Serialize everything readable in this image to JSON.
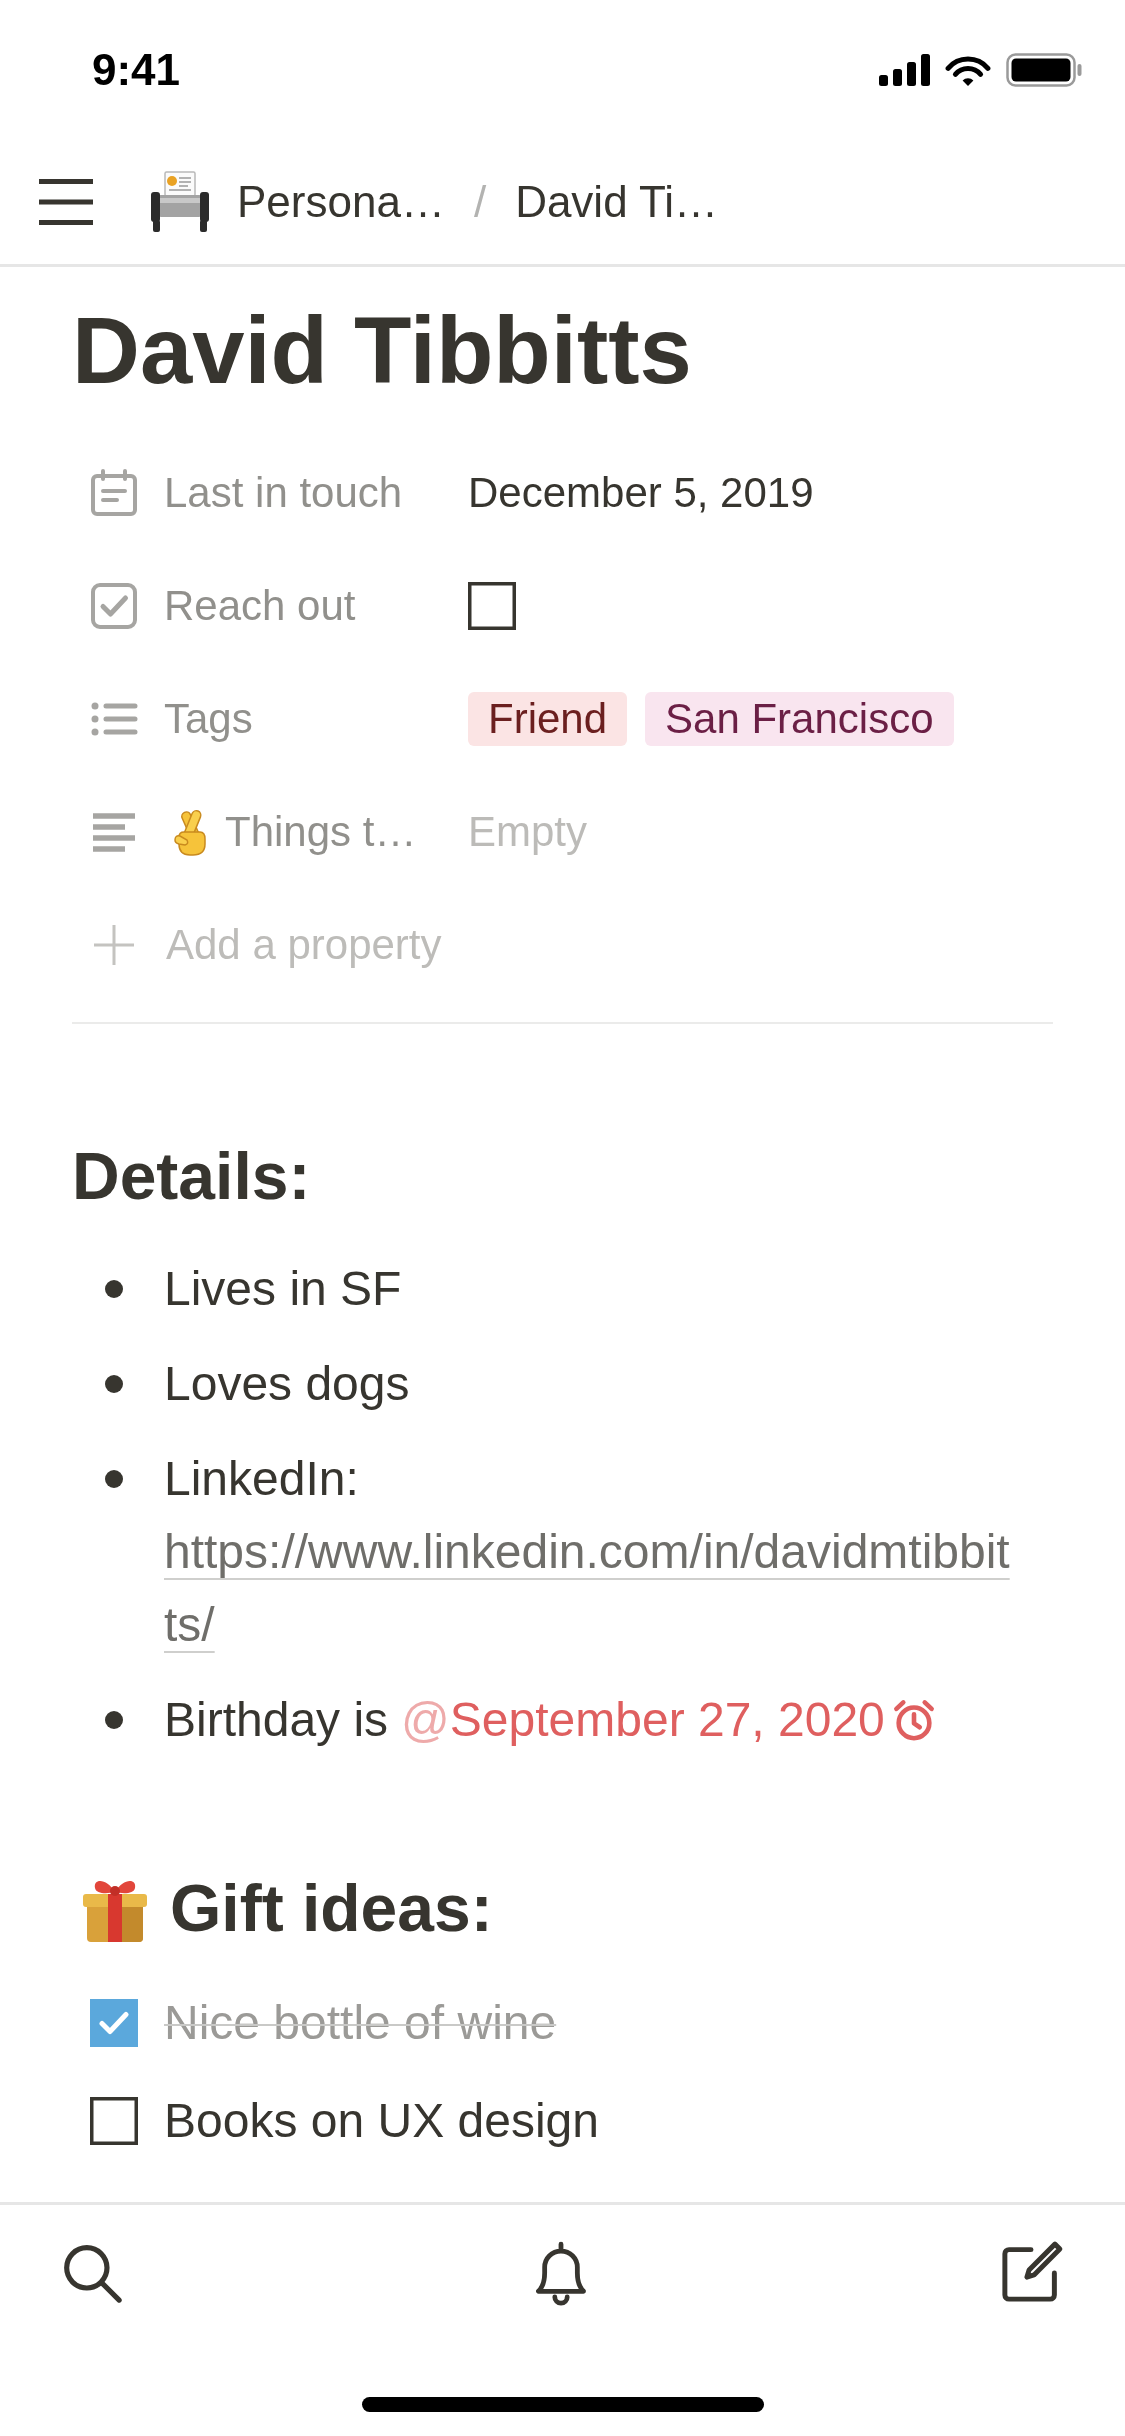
{
  "status_bar": {
    "time": "9:41"
  },
  "breadcrumbs": {
    "separator": "/",
    "items": [
      {
        "label": "Persona…",
        "icon": true
      },
      {
        "label": "David Ti…",
        "icon": false
      }
    ]
  },
  "page": {
    "title": "David Tibbitts"
  },
  "properties": [
    {
      "kind": "date",
      "name": "Last in touch",
      "value": "December 5, 2019"
    },
    {
      "kind": "checkbox",
      "name": "Reach out",
      "checked": false
    },
    {
      "kind": "multi_select",
      "name": "Tags",
      "tags": [
        {
          "label": "Friend",
          "color": "#fbe4e4"
        },
        {
          "label": "San Francisco",
          "color": "#f9e5ef"
        }
      ]
    },
    {
      "kind": "text",
      "name": "Things t…",
      "icon": true,
      "placeholder": "Empty"
    }
  ],
  "add_property": "Add a property",
  "sections": [
    {
      "kind": "bullets",
      "heading": "Details:",
      "icon": false,
      "items": [
        {
          "text": "Lives in SF"
        },
        {
          "text": "Loves dogs"
        },
        {
          "text": "LinkedIn:",
          "link": "https://www.linkedin.com/in/davidmtibbitts/"
        },
        {
          "text": "Birthday is",
          "mention": {
            "prefix": "@",
            "date": "September 27, 2020",
            "reminder": true
          }
        }
      ]
    },
    {
      "kind": "todos",
      "heading": "Gift ideas:",
      "icon": true,
      "items": [
        {
          "text": "Nice bottle of wine",
          "checked": true
        },
        {
          "text": "Books on UX design",
          "checked": false
        }
      ]
    }
  ]
}
